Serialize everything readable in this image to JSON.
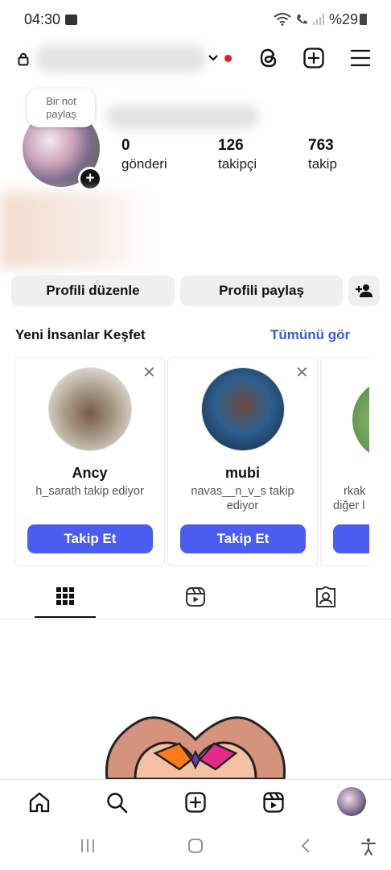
{
  "status_bar": {
    "time": "04:30",
    "battery": "%29",
    "icons": [
      "image-icon",
      "wifi-icon",
      "call-icon",
      "signal-icon",
      "battery-icon"
    ]
  },
  "header": {
    "icons": [
      "lock-icon",
      "chevron-down-icon",
      "threads-icon",
      "new-post-icon",
      "menu-icon"
    ],
    "notification_dot_color": "#e8192c"
  },
  "profile": {
    "note_text": "Bir not paylaş",
    "stats": [
      {
        "value": "0",
        "label": "gönderi"
      },
      {
        "value": "126",
        "label": "takipçi"
      },
      {
        "value": "763",
        "label": "takip"
      }
    ]
  },
  "actions": {
    "edit_label": "Profili düzenle",
    "share_label": "Profili paylaş"
  },
  "discover": {
    "title": "Yeni İnsanlar Keşfet",
    "see_all": "Tümünü gör",
    "cards": [
      {
        "name": "Ancy",
        "subtitle": "h_sarath takip ediyor",
        "button": "Takip Et"
      },
      {
        "name": "mubi",
        "subtitle": "navas__n_v_s takip ediyor",
        "button": "Takip Et"
      },
      {
        "name": "",
        "subtitle_line1": "rkak",
        "subtitle_line2": "diğer l",
        "button": ""
      }
    ],
    "accent_color": "#4a5df0"
  },
  "tabs": [
    "grid-icon",
    "reels-icon",
    "tagged-icon"
  ],
  "bottom_nav": [
    "home-icon",
    "search-icon",
    "create-icon",
    "reels-icon",
    "profile-avatar"
  ],
  "system_nav": [
    "recents-icon",
    "home-button-icon",
    "back-icon",
    "accessibility-icon"
  ]
}
